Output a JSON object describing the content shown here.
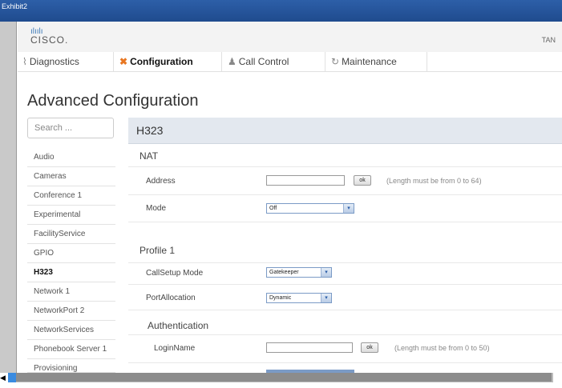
{
  "window": {
    "title": "Exhibit2"
  },
  "header": {
    "logo_text": "CISCO.",
    "logo_bars": "ılıılı",
    "user_partial": "TAN"
  },
  "nav": {
    "tabs": [
      {
        "label": "Diagnostics",
        "icon": "pulse-icon"
      },
      {
        "label": "Configuration",
        "icon": "wrench-icon"
      },
      {
        "label": "Call Control",
        "icon": "people-icon"
      },
      {
        "label": "Maintenance",
        "icon": "refresh-icon"
      }
    ]
  },
  "page": {
    "title": "Advanced Configuration"
  },
  "search": {
    "placeholder": "Search ..."
  },
  "sidebar": {
    "items": [
      {
        "label": "Audio"
      },
      {
        "label": "Cameras"
      },
      {
        "label": "Conference 1"
      },
      {
        "label": "Experimental"
      },
      {
        "label": "FacilityService"
      },
      {
        "label": "GPIO"
      },
      {
        "label": "H323"
      },
      {
        "label": "Network 1"
      },
      {
        "label": "NetworkPort 2"
      },
      {
        "label": "NetworkServices"
      },
      {
        "label": "Phonebook Server 1"
      },
      {
        "label": "Provisioning"
      }
    ]
  },
  "panel": {
    "title": "H323",
    "nat": {
      "heading": "NAT",
      "address_label": "Address",
      "address_value": "",
      "ok_label": "ok",
      "address_hint": "(Length must be from 0 to 64)",
      "mode_label": "Mode",
      "mode_value": "Off"
    },
    "profile": {
      "heading": "Profile 1",
      "callsetup_label": "CallSetup Mode",
      "callsetup_value": "Gatekeeper",
      "portalloc_label": "PortAllocation",
      "portalloc_value": "Dynamic",
      "auth_heading": "Authentication",
      "login_label": "LoginName",
      "login_value": "",
      "ok_label": "ok",
      "login_hint": "(Length must be from 0 to 50)"
    }
  }
}
